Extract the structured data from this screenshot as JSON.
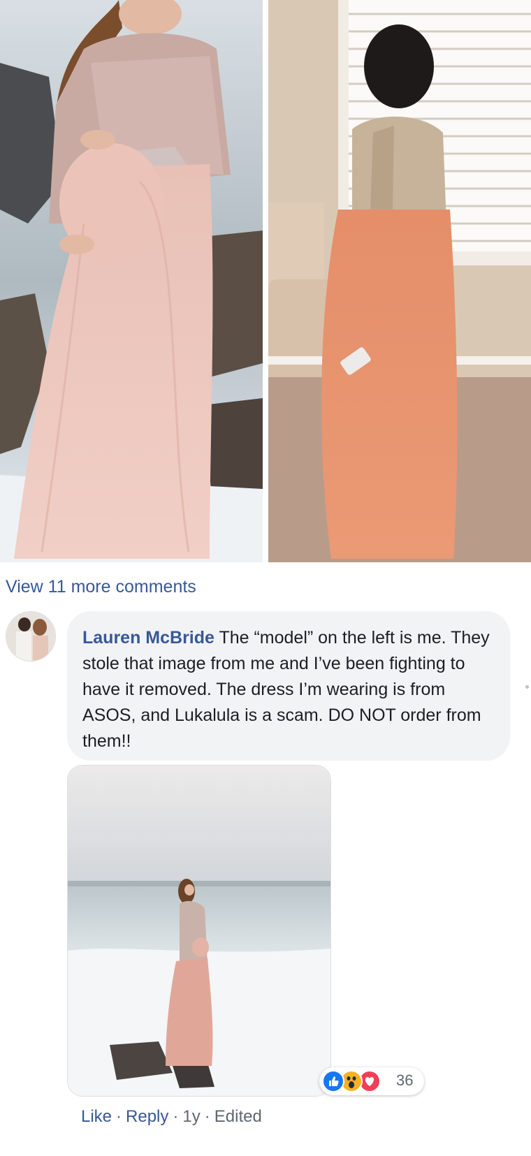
{
  "comments": {
    "view_more_label": "View 11 more comments"
  },
  "comment": {
    "author": "Lauren McBride",
    "text": "The “model” on the left is me. They stole that image from me and I’ve been fighting to have it removed. The dress I’m wearing is from ASOS, and Lukalula is a scam. DO NOT order from them!!",
    "reactions": {
      "icons": [
        "like-icon",
        "wow-icon",
        "love-icon"
      ],
      "count": "36"
    },
    "actions": {
      "like": "Like",
      "reply": "Reply",
      "time": "1y",
      "edited": "Edited"
    }
  },
  "colors": {
    "link": "#385898",
    "bubble": "#f2f3f5",
    "meta": "#606770",
    "like": "#1877f2",
    "wow": "#f7b125",
    "love": "#f33e58"
  }
}
